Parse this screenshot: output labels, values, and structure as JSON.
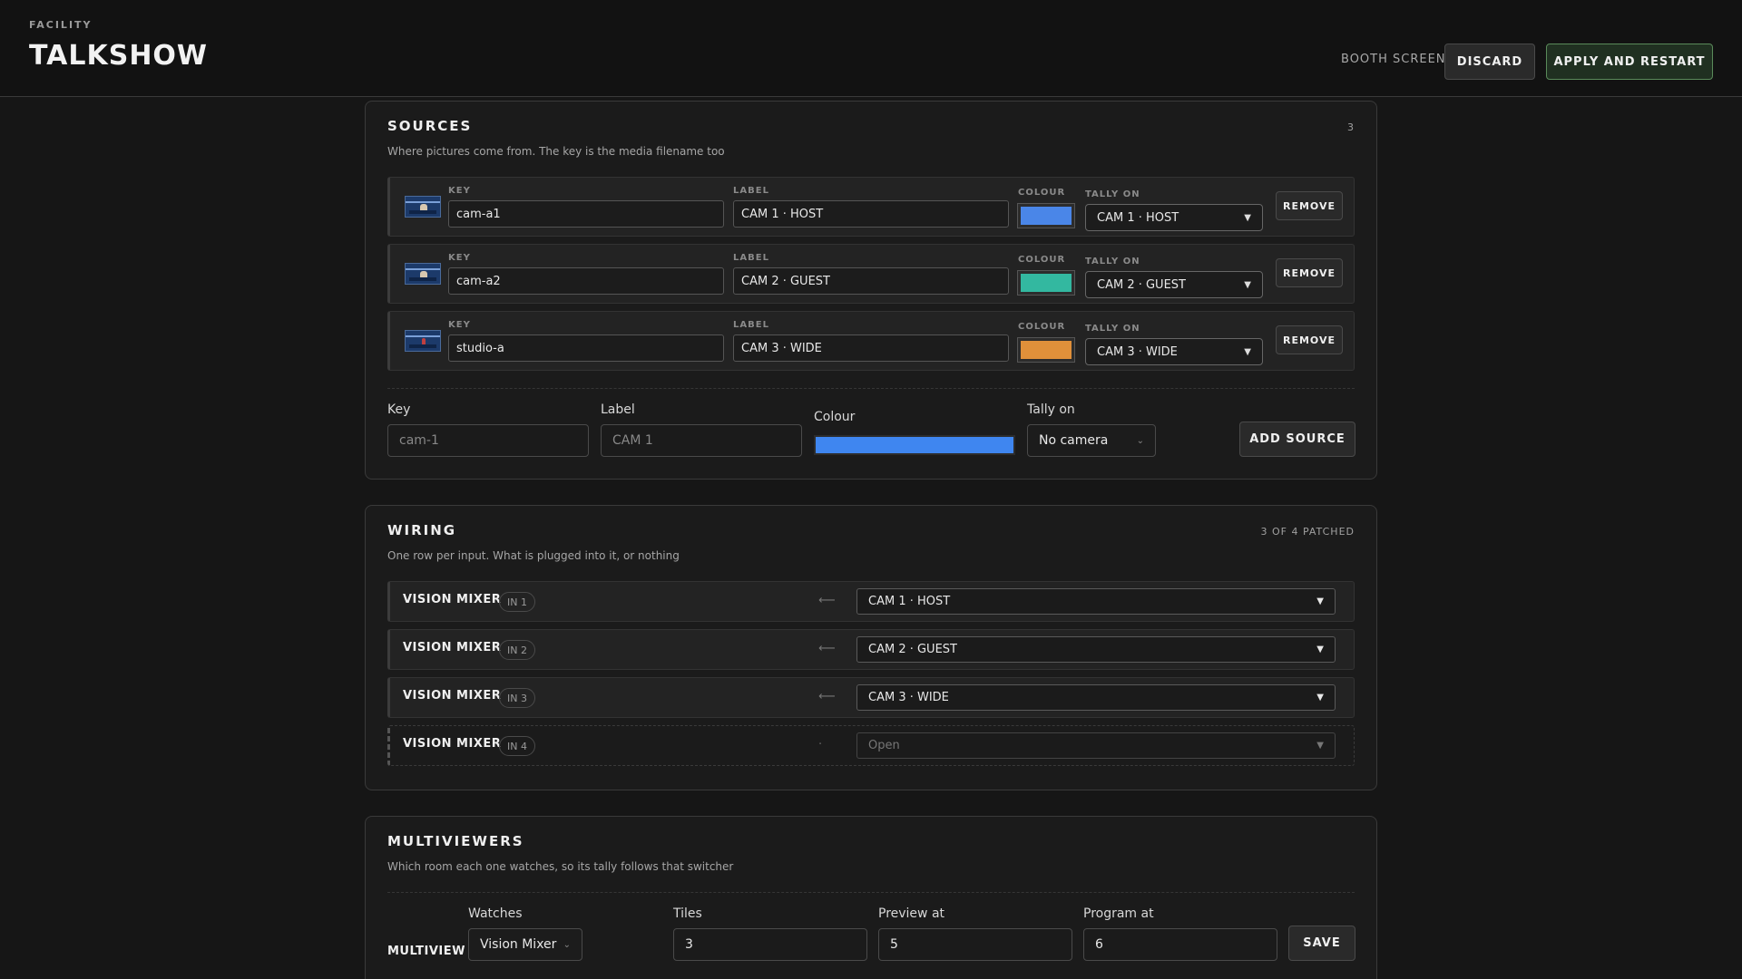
{
  "header": {
    "eyebrow": "FACILITY",
    "title": "TALKSHOW",
    "booth": "BOOTH SCREEN",
    "discard": "DISCARD",
    "apply": "APPLY AND RESTART"
  },
  "sources": {
    "title": "SOURCES",
    "count": "3",
    "subtitle": "Where pictures come from. The key is the media filename too",
    "labels": {
      "key": "KEY",
      "label": "LABEL",
      "colour": "COLOUR",
      "tally": "TALLY ON",
      "remove": "REMOVE"
    },
    "rows": [
      {
        "key": "cam-a1",
        "label": "CAM 1 · HOST",
        "colour": "#4a86e8",
        "tally": "CAM 1 · HOST"
      },
      {
        "key": "cam-a2",
        "label": "CAM 2 · GUEST",
        "colour": "#33b8a0",
        "tally": "CAM 2 · GUEST"
      },
      {
        "key": "studio-a",
        "label": "CAM 3 · WIDE",
        "colour": "#e0903a",
        "tally": "CAM 3 · WIDE"
      }
    ],
    "add_form": {
      "key_label": "Key",
      "key_placeholder": "cam-1",
      "label_label": "Label",
      "label_placeholder": "CAM 1",
      "colour_label": "Colour",
      "colour_value": "#3f86f0",
      "tally_label": "Tally on",
      "tally_value": "No camera",
      "add_button": "ADD SOURCE"
    }
  },
  "wiring": {
    "title": "WIRING",
    "count": "3 OF 4 PATCHED",
    "subtitle": "One row per input. What is plugged into it, or nothing",
    "rows": [
      {
        "device": "VISION MIXER",
        "input": "IN 1",
        "source": "CAM 1 · HOST"
      },
      {
        "device": "VISION MIXER",
        "input": "IN 2",
        "source": "CAM 2 · GUEST"
      },
      {
        "device": "VISION MIXER",
        "input": "IN 3",
        "source": "CAM 3 · WIDE"
      },
      {
        "device": "VISION MIXER",
        "input": "IN 4",
        "source": "Open"
      }
    ]
  },
  "multiviewers": {
    "title": "MULTIVIEWERS",
    "subtitle": "Which room each one watches, so its tally follows that switcher",
    "row": {
      "name": "MULTIVIEW",
      "watches_label": "Watches",
      "watches_value": "Vision Mixer",
      "tiles_label": "Tiles",
      "tiles_value": "3",
      "preview_label": "Preview at",
      "preview_value": "5",
      "program_label": "Program at",
      "program_value": "6",
      "save": "SAVE"
    }
  },
  "colors": {
    "background": "#161616",
    "panel": "#1b1b1b",
    "apply_border": "#5a8a5a"
  }
}
